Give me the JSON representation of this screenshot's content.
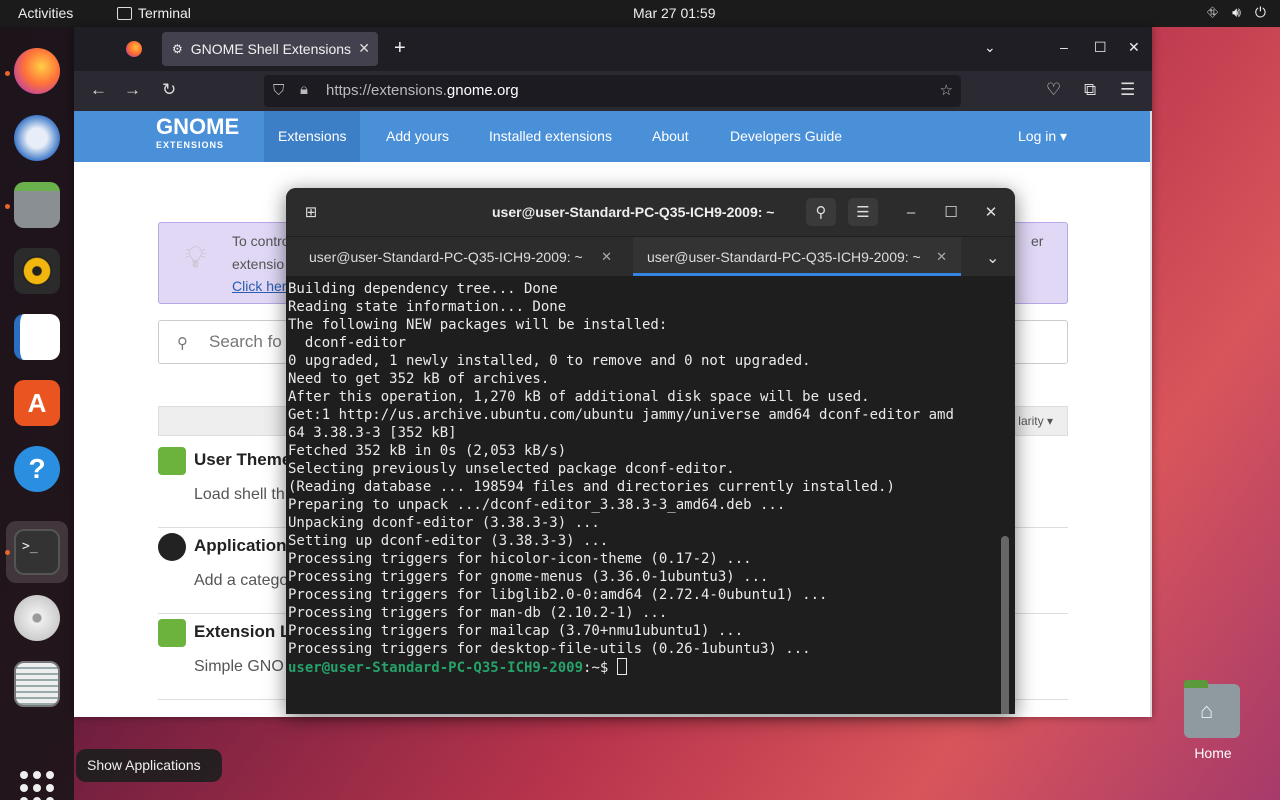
{
  "topbar": {
    "activities": "Activities",
    "app_name": "Terminal",
    "clock": "Mar 27  01:59"
  },
  "browser": {
    "tab_title": "GNOME Shell Extensions",
    "url_prefix": "https://extensions.",
    "url_domain": "gnome.org"
  },
  "site": {
    "logo_big": "GNOME",
    "logo_small": "EXTENSIONS",
    "nav": [
      "Extensions",
      "Add yours",
      "Installed extensions",
      "About",
      "Developers Guide"
    ],
    "login": "Log in",
    "info_line1": "To contro",
    "info_line1_right": "er",
    "info_line2": "extensio",
    "info_link": "Click her",
    "search_placeholder": "Search fo",
    "sort_label": "larity",
    "extensions": [
      {
        "name": "User Theme",
        "desc": "Load shell th"
      },
      {
        "name": "Application",
        "desc": "Add a catego"
      },
      {
        "name": "Extension L",
        "desc": "Simple GNO"
      }
    ]
  },
  "terminal": {
    "title": "user@user-Standard-PC-Q35-ICH9-2009: ~",
    "tabs": [
      "user@user-Standard-PC-Q35-ICH9-2009: ~",
      "user@user-Standard-PC-Q35-ICH9-2009: ~"
    ],
    "lines": [
      "Building dependency tree... Done",
      "Reading state information... Done",
      "The following NEW packages will be installed:",
      "  dconf-editor",
      "0 upgraded, 1 newly installed, 0 to remove and 0 not upgraded.",
      "Need to get 352 kB of archives.",
      "After this operation, 1,270 kB of additional disk space will be used.",
      "Get:1 http://us.archive.ubuntu.com/ubuntu jammy/universe amd64 dconf-editor amd",
      "64 3.38.3-3 [352 kB]",
      "Fetched 352 kB in 0s (2,053 kB/s)",
      "Selecting previously unselected package dconf-editor.",
      "(Reading database ... 198594 files and directories currently installed.)",
      "Preparing to unpack .../dconf-editor_3.38.3-3_amd64.deb ...",
      "Unpacking dconf-editor (3.38.3-3) ...",
      "Setting up dconf-editor (3.38.3-3) ...",
      "Processing triggers for hicolor-icon-theme (0.17-2) ...",
      "Processing triggers for gnome-menus (3.36.0-1ubuntu3) ...",
      "Processing triggers for libglib2.0-0:amd64 (2.72.4-0ubuntu1) ...",
      "Processing triggers for man-db (2.10.2-1) ...",
      "Processing triggers for mailcap (3.70+nmu1ubuntu1) ...",
      "Processing triggers for desktop-file-utils (0.26-1ubuntu3) ..."
    ],
    "prompt_user": "user@user-Standard-PC-Q35-ICH9-2009",
    "prompt_suffix": ":~$ "
  },
  "desktop": {
    "home_label": "Home",
    "tooltip": "Show Applications"
  },
  "dock_items": [
    "firefox-icon",
    "thunderbird-icon",
    "files-icon",
    "rhythmbox-icon",
    "libreoffice-writer-icon",
    "app-center-icon",
    "help-icon",
    "terminal-icon",
    "disc-icon",
    "text-editor-icon",
    "show-apps-icon"
  ]
}
